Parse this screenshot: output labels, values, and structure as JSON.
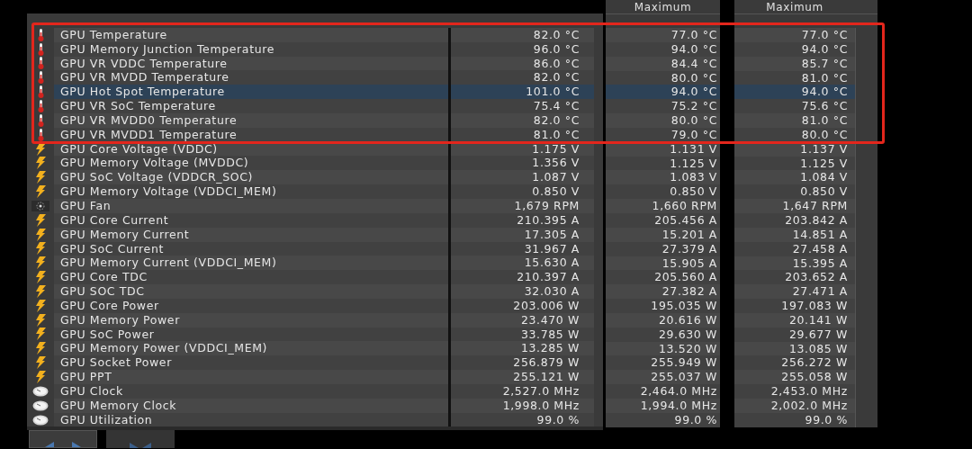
{
  "columns": [
    "Maximum",
    "Maximum"
  ],
  "rows": [
    {
      "kind": "thermometer",
      "label": "GPU Temperature",
      "values": [
        "82.0 °C",
        "77.0 °C",
        "77.0 °C"
      ],
      "selected": false
    },
    {
      "kind": "thermometer",
      "label": "GPU Memory Junction Temperature",
      "values": [
        "96.0 °C",
        "94.0 °C",
        "94.0 °C"
      ],
      "selected": false
    },
    {
      "kind": "thermometer",
      "label": "GPU VR VDDC Temperature",
      "values": [
        "86.0 °C",
        "84.4 °C",
        "85.7 °C"
      ],
      "selected": false
    },
    {
      "kind": "thermometer",
      "label": "GPU VR MVDD Temperature",
      "values": [
        "82.0 °C",
        "80.0 °C",
        "81.0 °C"
      ],
      "selected": false
    },
    {
      "kind": "thermometer",
      "label": "GPU Hot Spot Temperature",
      "values": [
        "101.0 °C",
        "94.0 °C",
        "94.0 °C"
      ],
      "selected": true
    },
    {
      "kind": "thermometer",
      "label": "GPU VR SoC Temperature",
      "values": [
        "75.4 °C",
        "75.2 °C",
        "75.6 °C"
      ],
      "selected": false
    },
    {
      "kind": "thermometer",
      "label": "GPU VR MVDD0 Temperature",
      "values": [
        "82.0 °C",
        "80.0 °C",
        "81.0 °C"
      ],
      "selected": false
    },
    {
      "kind": "thermometer",
      "label": "GPU VR MVDD1 Temperature",
      "values": [
        "81.0 °C",
        "79.0 °C",
        "80.0 °C"
      ],
      "selected": false
    },
    {
      "kind": "bolt",
      "label": "GPU Core Voltage (VDDC)",
      "values": [
        "1.175 V",
        "1.131 V",
        "1.137 V"
      ],
      "selected": false
    },
    {
      "kind": "bolt",
      "label": "GPU Memory Voltage (MVDDC)",
      "values": [
        "1.356 V",
        "1.125 V",
        "1.125 V"
      ],
      "selected": false
    },
    {
      "kind": "bolt",
      "label": "GPU SoC Voltage (VDDCR_SOC)",
      "values": [
        "1.087 V",
        "1.083 V",
        "1.084 V"
      ],
      "selected": false
    },
    {
      "kind": "bolt",
      "label": "GPU Memory Voltage (VDDCI_MEM)",
      "values": [
        "0.850 V",
        "0.850 V",
        "0.850 V"
      ],
      "selected": false
    },
    {
      "kind": "fan",
      "label": "GPU Fan",
      "values": [
        "1,679 RPM",
        "1,660 RPM",
        "1,647 RPM"
      ],
      "selected": false
    },
    {
      "kind": "bolt",
      "label": "GPU Core Current",
      "values": [
        "210.395 A",
        "205.456 A",
        "203.842 A"
      ],
      "selected": false
    },
    {
      "kind": "bolt",
      "label": "GPU Memory Current",
      "values": [
        "17.305 A",
        "15.201 A",
        "14.851 A"
      ],
      "selected": false
    },
    {
      "kind": "bolt",
      "label": "GPU SoC Current",
      "values": [
        "31.967 A",
        "27.379 A",
        "27.458 A"
      ],
      "selected": false
    },
    {
      "kind": "bolt",
      "label": "GPU Memory Current (VDDCI_MEM)",
      "values": [
        "15.630 A",
        "15.905 A",
        "15.395 A"
      ],
      "selected": false
    },
    {
      "kind": "bolt",
      "label": "GPU Core TDC",
      "values": [
        "210.397 A",
        "205.560 A",
        "203.652 A"
      ],
      "selected": false
    },
    {
      "kind": "bolt",
      "label": "GPU SOC TDC",
      "values": [
        "32.030 A",
        "27.382 A",
        "27.471 A"
      ],
      "selected": false
    },
    {
      "kind": "bolt",
      "label": "GPU Core Power",
      "values": [
        "203.006 W",
        "195.035 W",
        "197.083 W"
      ],
      "selected": false
    },
    {
      "kind": "bolt",
      "label": "GPU Memory Power",
      "values": [
        "23.470 W",
        "20.616 W",
        "20.141 W"
      ],
      "selected": false
    },
    {
      "kind": "bolt",
      "label": "GPU SoC Power",
      "values": [
        "33.785 W",
        "29.630 W",
        "29.677 W"
      ],
      "selected": false
    },
    {
      "kind": "bolt",
      "label": "GPU Memory Power (VDDCI_MEM)",
      "values": [
        "13.285 W",
        "13.520 W",
        "13.085 W"
      ],
      "selected": false
    },
    {
      "kind": "bolt",
      "label": "GPU Socket Power",
      "values": [
        "256.879 W",
        "255.949 W",
        "256.272 W"
      ],
      "selected": false
    },
    {
      "kind": "bolt",
      "label": "GPU PPT",
      "values": [
        "255.121 W",
        "255.037 W",
        "255.058 W"
      ],
      "selected": false
    },
    {
      "kind": "clock",
      "label": "GPU Clock",
      "values": [
        "2,527.0 MHz",
        "2,464.0 MHz",
        "2,453.0 MHz"
      ],
      "selected": false
    },
    {
      "kind": "clock",
      "label": "GPU Memory Clock",
      "values": [
        "1,998.0 MHz",
        "1,994.0 MHz",
        "2,002.0 MHz"
      ],
      "selected": false
    },
    {
      "kind": "clock",
      "label": "GPU Utilization",
      "values": [
        "99.0 %",
        "99.0 %",
        "99.0 %"
      ],
      "selected": false
    }
  ]
}
